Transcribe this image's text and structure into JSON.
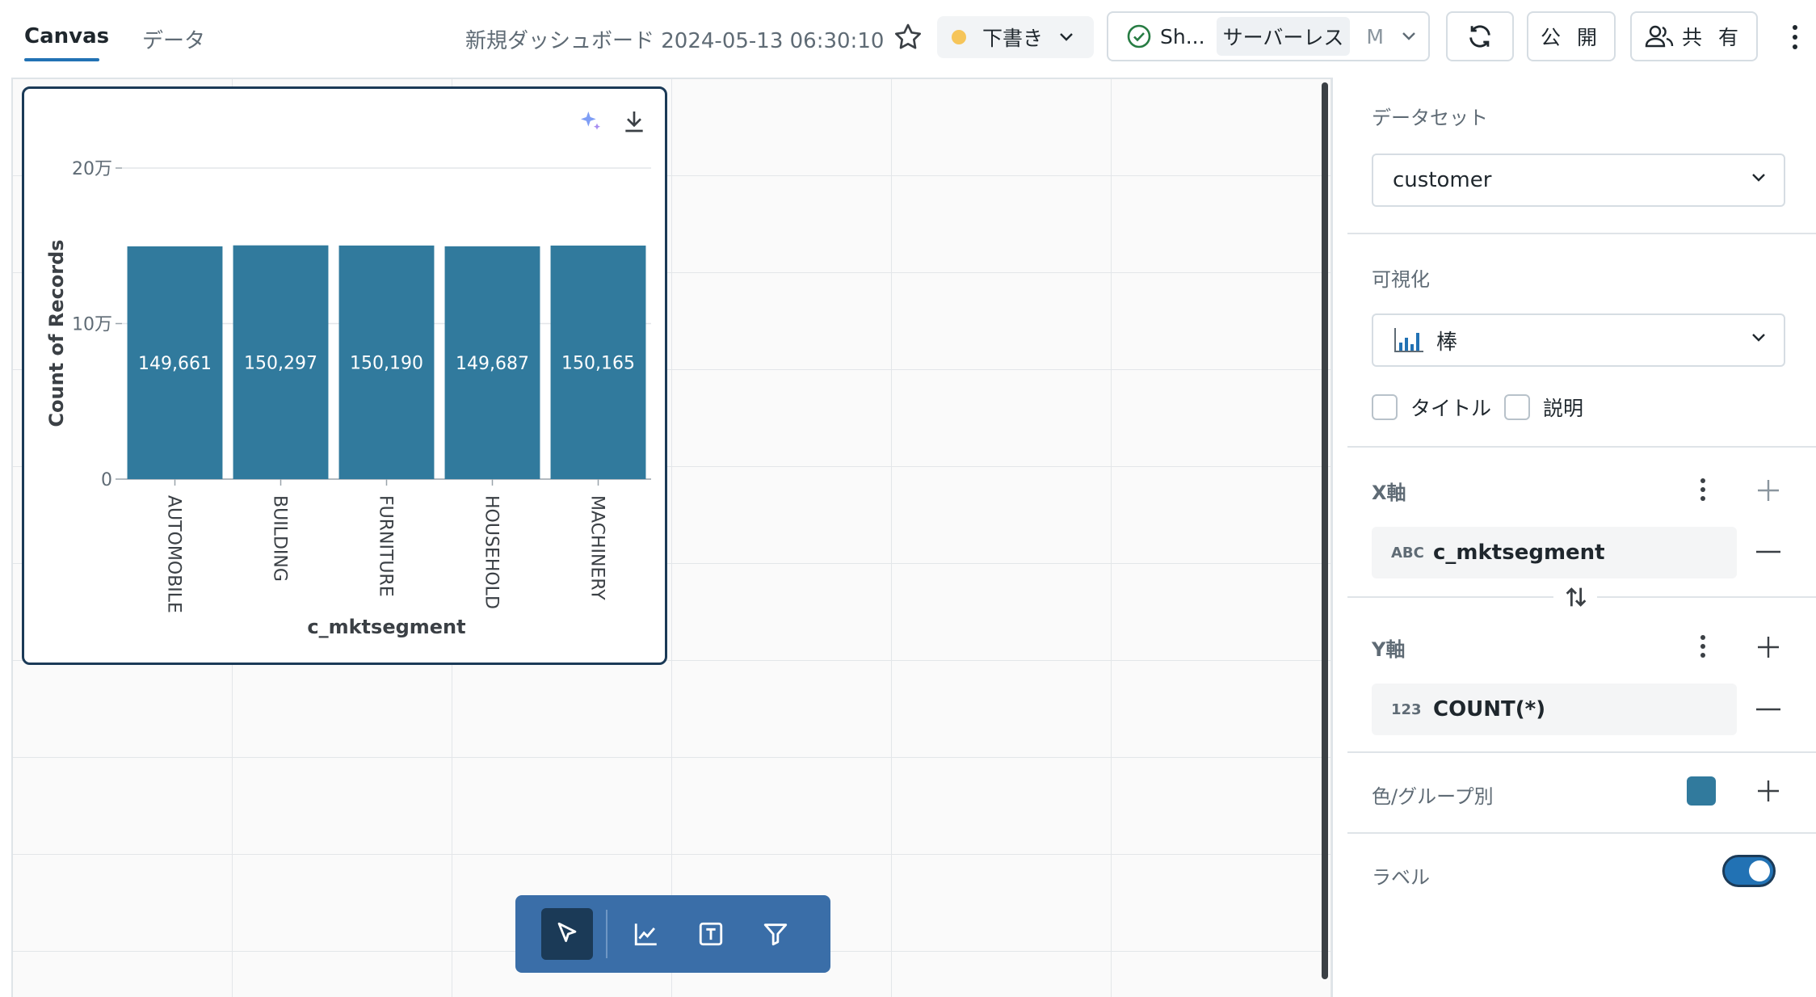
{
  "tabs": {
    "canvas": "Canvas",
    "data": "データ"
  },
  "dashboard": {
    "title": "新規ダッシュボード 2024-05-13 06:30:10"
  },
  "status": {
    "draft_label": "下書き"
  },
  "compute": {
    "name": "Sh...",
    "type": "サーバーレス",
    "size": "M"
  },
  "actions": {
    "publish": "公 開",
    "share": "共 有"
  },
  "colors": {
    "accent": "#2272b4",
    "bar": "#317a9d",
    "toolbar": "#3a6ea8",
    "selected_border": "#1b3a57"
  },
  "panel": {
    "dataset_label": "データセット",
    "dataset_value": "customer",
    "viz_label": "可視化",
    "viz_value": "棒",
    "title_checkbox": "タイトル",
    "desc_checkbox": "説明",
    "x_axis_label": "X軸",
    "x_field": "c_mktsegment",
    "x_field_type": "ABC",
    "y_axis_label": "Y軸",
    "y_field": "COUNT(*)",
    "y_field_type": "123",
    "color_label": "色/グループ別",
    "label_toggle": "ラベル",
    "label_toggle_on": true
  },
  "chart_data": {
    "type": "bar",
    "categories": [
      "AUTOMOBILE",
      "BUILDING",
      "FURNITURE",
      "HOUSEHOLD",
      "MACHINERY"
    ],
    "values": [
      149661,
      150297,
      150190,
      149687,
      150165
    ],
    "data_labels": [
      "149,661",
      "150,297",
      "150,190",
      "149,687",
      "150,165"
    ],
    "xlabel": "c_mktsegment",
    "ylabel": "Count of Records",
    "yticks": [
      0,
      100000,
      200000
    ],
    "ytick_labels": [
      "0",
      "10万",
      "20万"
    ],
    "ylim": [
      0,
      200000
    ],
    "grid": true,
    "legend": "none"
  }
}
